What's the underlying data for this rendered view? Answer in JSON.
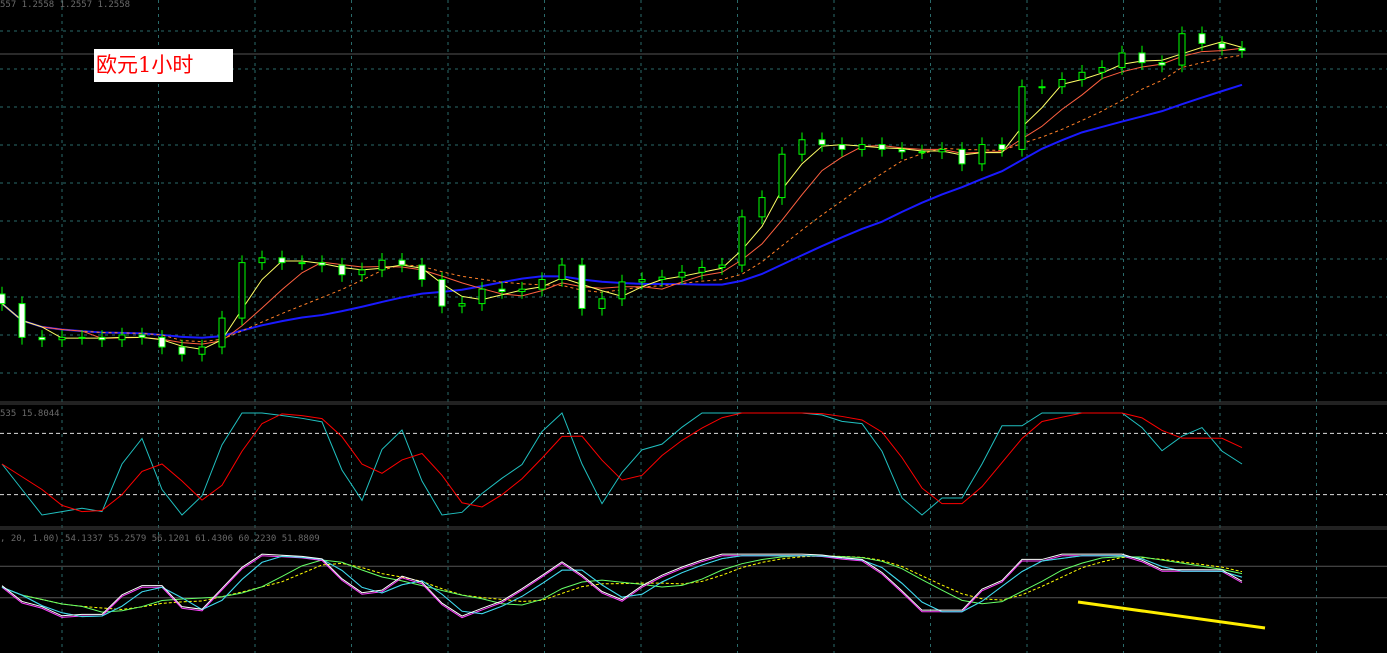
{
  "chart_title": "欧元1小时",
  "ohlc_readout": "557 1.2558 1.2557 1.2558",
  "stoch_readout": "535 15.8044",
  "oscillator_readout": ", 20, 1.00) 54.1337 55.2579 56.1201 61.4306 60.2230 51.8809",
  "colors": {
    "bull": "#00ff00",
    "bear": "#ffffff",
    "ma_fast": "#ffff66",
    "ma_mid": "#ff6040",
    "ma_dash": "#ff7f27",
    "ma_slow": "#1a1aff",
    "stoch_main": "#20c0c0",
    "stoch_signal": "#ff0000",
    "grid": "#2a6a6a",
    "trend": "#ffee00"
  },
  "chart_data": {
    "type": "line",
    "title": "欧元1小时",
    "series_type": "candlestick",
    "close": [
      1.2452,
      1.2438,
      1.2437,
      1.2438,
      1.2438,
      1.2437,
      1.2439,
      1.2438,
      1.2434,
      1.2431,
      1.2434,
      1.2446,
      1.2469,
      1.2471,
      1.2469,
      1.2469,
      1.2468,
      1.2464,
      1.2466,
      1.247,
      1.2468,
      1.2462,
      1.2451,
      1.2452,
      1.2458,
      1.2457,
      1.2458,
      1.2462,
      1.2468,
      1.245,
      1.2454,
      1.2461,
      1.2462,
      1.2463,
      1.2465,
      1.2467,
      1.2468,
      1.2488,
      1.2496,
      1.2514,
      1.252,
      1.2518,
      1.2516,
      1.2518,
      1.2516,
      1.2515,
      1.2515,
      1.2516,
      1.251,
      1.2518,
      1.2516,
      1.2542,
      1.2542,
      1.2545,
      1.2548,
      1.255,
      1.2556,
      1.2552,
      1.2551,
      1.2564,
      1.256,
      1.2558,
      1.2557
    ],
    "ylim": [
      1.2412,
      1.2578
    ],
    "stoch_levels": [
      80,
      20
    ],
    "grid": true
  }
}
